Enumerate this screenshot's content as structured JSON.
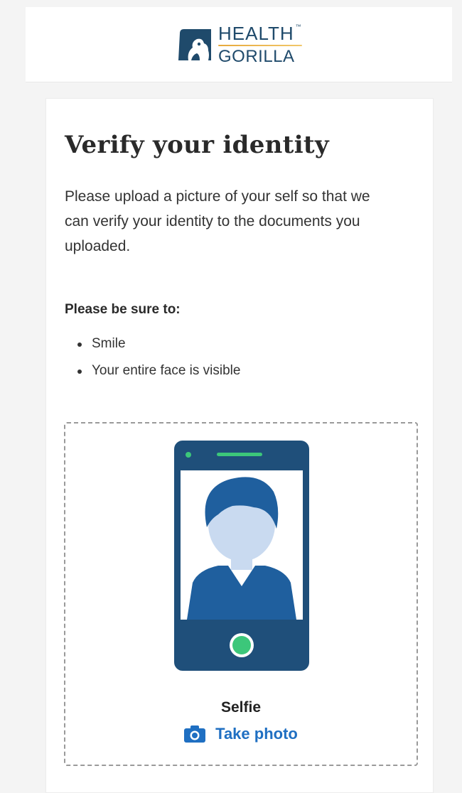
{
  "header": {
    "logo_line1": "HEALTH",
    "logo_tm": "™",
    "logo_line2": "GORILLA"
  },
  "main": {
    "title": "Verify your identity",
    "description": "Please upload a picture of your self so that we can verify your identity to the documents you uploaded.",
    "be_sure_heading": "Please be sure to:",
    "tips": [
      "Smile",
      "Your entire face is visible"
    ]
  },
  "upload": {
    "label": "Selfie",
    "action_label": "Take photo",
    "icons": {
      "illustration": "phone-selfie-illustration",
      "action": "camera-icon"
    }
  },
  "colors": {
    "brand_navy": "#1f4a6b",
    "phone_dark": "#1f4f7a",
    "person_blue": "#1f5f9e",
    "face_light": "#c9daf0",
    "shutter_green": "#3cc77a",
    "link_blue": "#1f6fc2",
    "logo_swoosh": "#e7a93b"
  }
}
